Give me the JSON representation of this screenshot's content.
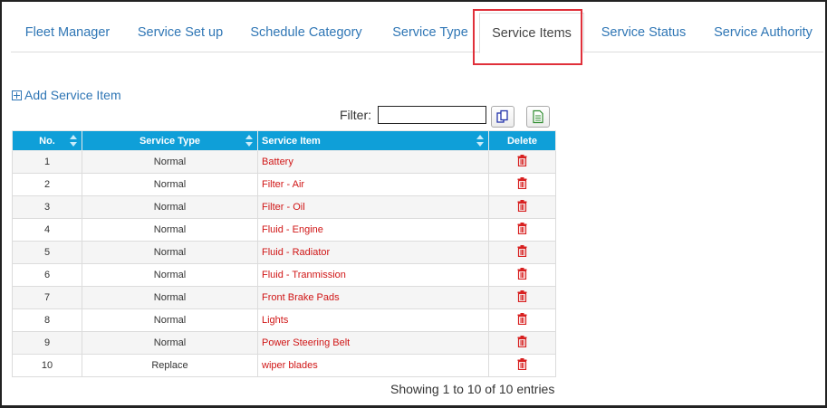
{
  "tabs": [
    {
      "label": "Fleet Manager",
      "active": false
    },
    {
      "label": "Service Set up",
      "active": false
    },
    {
      "label": "Schedule Category",
      "active": false
    },
    {
      "label": "Service Type",
      "active": false
    },
    {
      "label": "Service Items",
      "active": true
    },
    {
      "label": "Service Status",
      "active": false
    },
    {
      "label": "Service Authority",
      "active": false
    }
  ],
  "add_item_label": "Add Service Item",
  "filter": {
    "label": "Filter:",
    "value": ""
  },
  "toolbar": {
    "copy_icon": "copy-icon",
    "export_icon": "spreadsheet-icon"
  },
  "table": {
    "columns": [
      "No.",
      "Service Type",
      "Service Item",
      "Delete"
    ],
    "rows": [
      {
        "no": "1",
        "type": "Normal",
        "item": "Battery"
      },
      {
        "no": "2",
        "type": "Normal",
        "item": "Filter - Air"
      },
      {
        "no": "3",
        "type": "Normal",
        "item": "Filter - Oil"
      },
      {
        "no": "4",
        "type": "Normal",
        "item": "Fluid - Engine"
      },
      {
        "no": "5",
        "type": "Normal",
        "item": "Fluid - Radiator"
      },
      {
        "no": "6",
        "type": "Normal",
        "item": "Fluid - Tranmission"
      },
      {
        "no": "7",
        "type": "Normal",
        "item": "Front Brake Pads"
      },
      {
        "no": "8",
        "type": "Normal",
        "item": "Lights"
      },
      {
        "no": "9",
        "type": "Normal",
        "item": "Power Steering Belt"
      },
      {
        "no": "10",
        "type": "Replace",
        "item": "wiper blades"
      }
    ],
    "delete_icon": "trash-icon"
  },
  "info": "Showing 1 to 10 of 10 entries",
  "colors": {
    "header": "#0f9fd8",
    "link": "#2f76b5",
    "item_text": "#d01616",
    "highlight": "#e0303a"
  }
}
